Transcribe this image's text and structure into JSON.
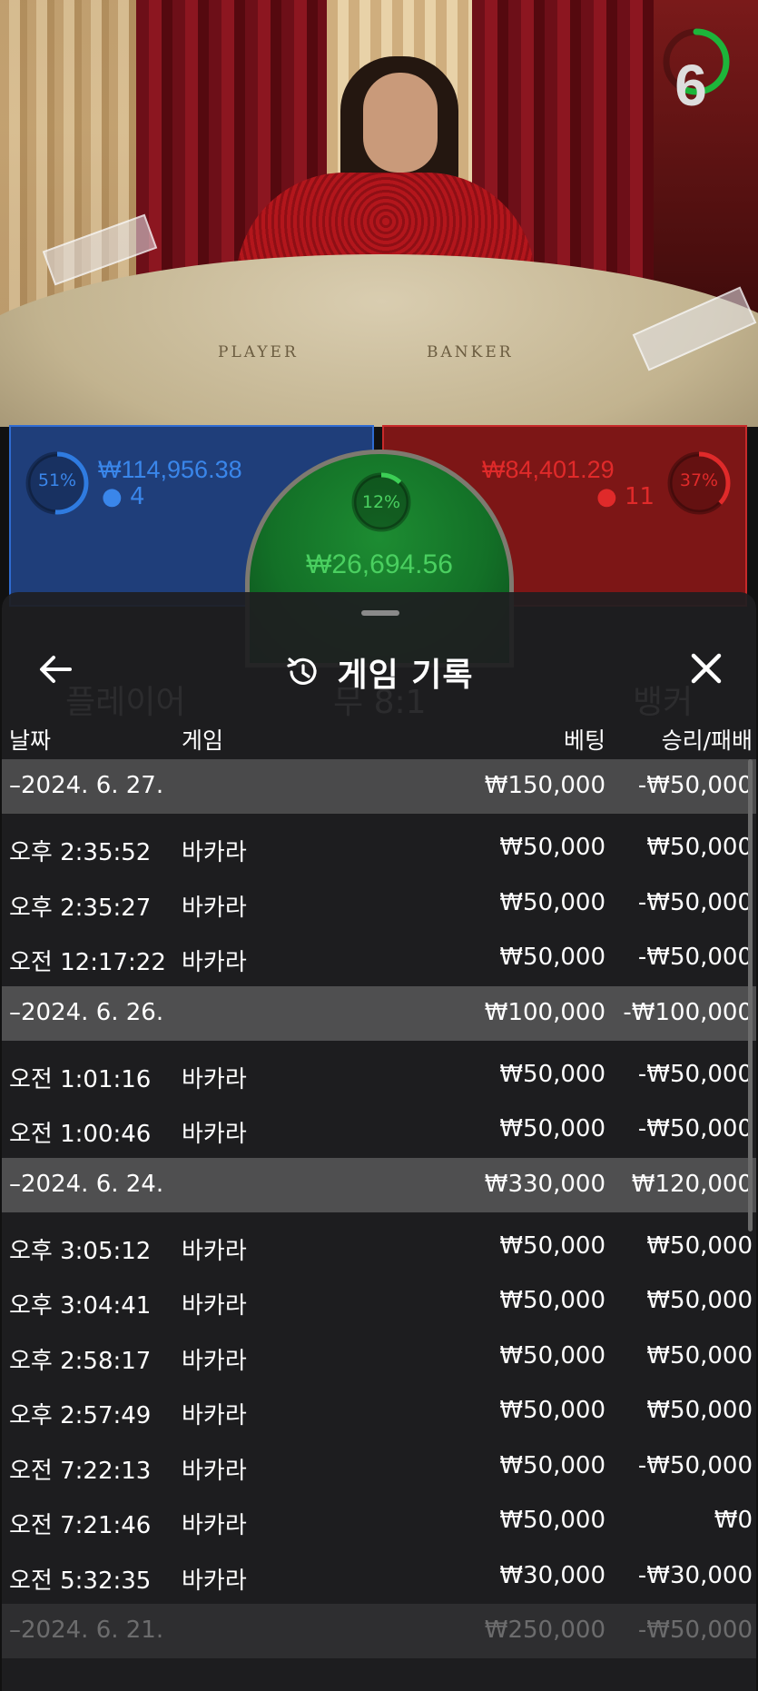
{
  "timer": {
    "value": "6",
    "fraction": 0.55,
    "color": "#1db53a"
  },
  "table": {
    "player_label": "PLAYER",
    "banker_label": "BANKER"
  },
  "bets": {
    "player": {
      "pct": "51%",
      "amount": "₩114,956.38",
      "count": "4",
      "color": "#2f7be0",
      "fraction": 0.51
    },
    "banker": {
      "pct": "37%",
      "amount": "₩84,401.29",
      "count": "11",
      "color": "#e02a2a",
      "fraction": 0.37
    },
    "tie": {
      "pct": "12%",
      "amount": "₩26,694.56",
      "fraction": 0.12
    }
  },
  "history": {
    "title": "게임 기록",
    "back_icon": "arrow-left-icon",
    "history_icon": "history-clock-icon",
    "close_icon": "close-icon",
    "columns": {
      "date": "날짜",
      "game": "게임",
      "bet": "베팅",
      "result": "승리/패배"
    },
    "groups": [
      {
        "date": "–2024. 6. 27.",
        "bet": "₩150,000",
        "result": "-₩50,000",
        "rows": [
          {
            "time": "오후 2:35:52",
            "game": "바카라",
            "bet": "₩50,000",
            "result": "₩50,000"
          },
          {
            "time": "오후 2:35:27",
            "game": "바카라",
            "bet": "₩50,000",
            "result": "-₩50,000"
          },
          {
            "time": "오전 12:17:22",
            "game": "바카라",
            "bet": "₩50,000",
            "result": "-₩50,000"
          }
        ]
      },
      {
        "date": "–2024. 6. 26.",
        "bet": "₩100,000",
        "result": "-₩100,000",
        "rows": [
          {
            "time": "오전 1:01:16",
            "game": "바카라",
            "bet": "₩50,000",
            "result": "-₩50,000"
          },
          {
            "time": "오전 1:00:46",
            "game": "바카라",
            "bet": "₩50,000",
            "result": "-₩50,000"
          }
        ]
      },
      {
        "date": "–2024. 6. 24.",
        "bet": "₩330,000",
        "result": "₩120,000",
        "rows": [
          {
            "time": "오후 3:05:12",
            "game": "바카라",
            "bet": "₩50,000",
            "result": "₩50,000"
          },
          {
            "time": "오후 3:04:41",
            "game": "바카라",
            "bet": "₩50,000",
            "result": "₩50,000"
          },
          {
            "time": "오후 2:58:17",
            "game": "바카라",
            "bet": "₩50,000",
            "result": "₩50,000"
          },
          {
            "time": "오후 2:57:49",
            "game": "바카라",
            "bet": "₩50,000",
            "result": "₩50,000"
          },
          {
            "time": "오전 7:22:13",
            "game": "바카라",
            "bet": "₩50,000",
            "result": "-₩50,000"
          },
          {
            "time": "오전 7:21:46",
            "game": "바카라",
            "bet": "₩50,000",
            "result": "₩0"
          },
          {
            "time": "오전 5:32:35",
            "game": "바카라",
            "bet": "₩30,000",
            "result": "-₩30,000"
          }
        ]
      },
      {
        "date": "–2024. 6. 21.",
        "bet": "₩250,000",
        "result": "-₩50,000",
        "rows": []
      }
    ]
  },
  "background_labels": {
    "player": "플레이어",
    "tie": "무 8:1",
    "banker": "뱅커"
  }
}
